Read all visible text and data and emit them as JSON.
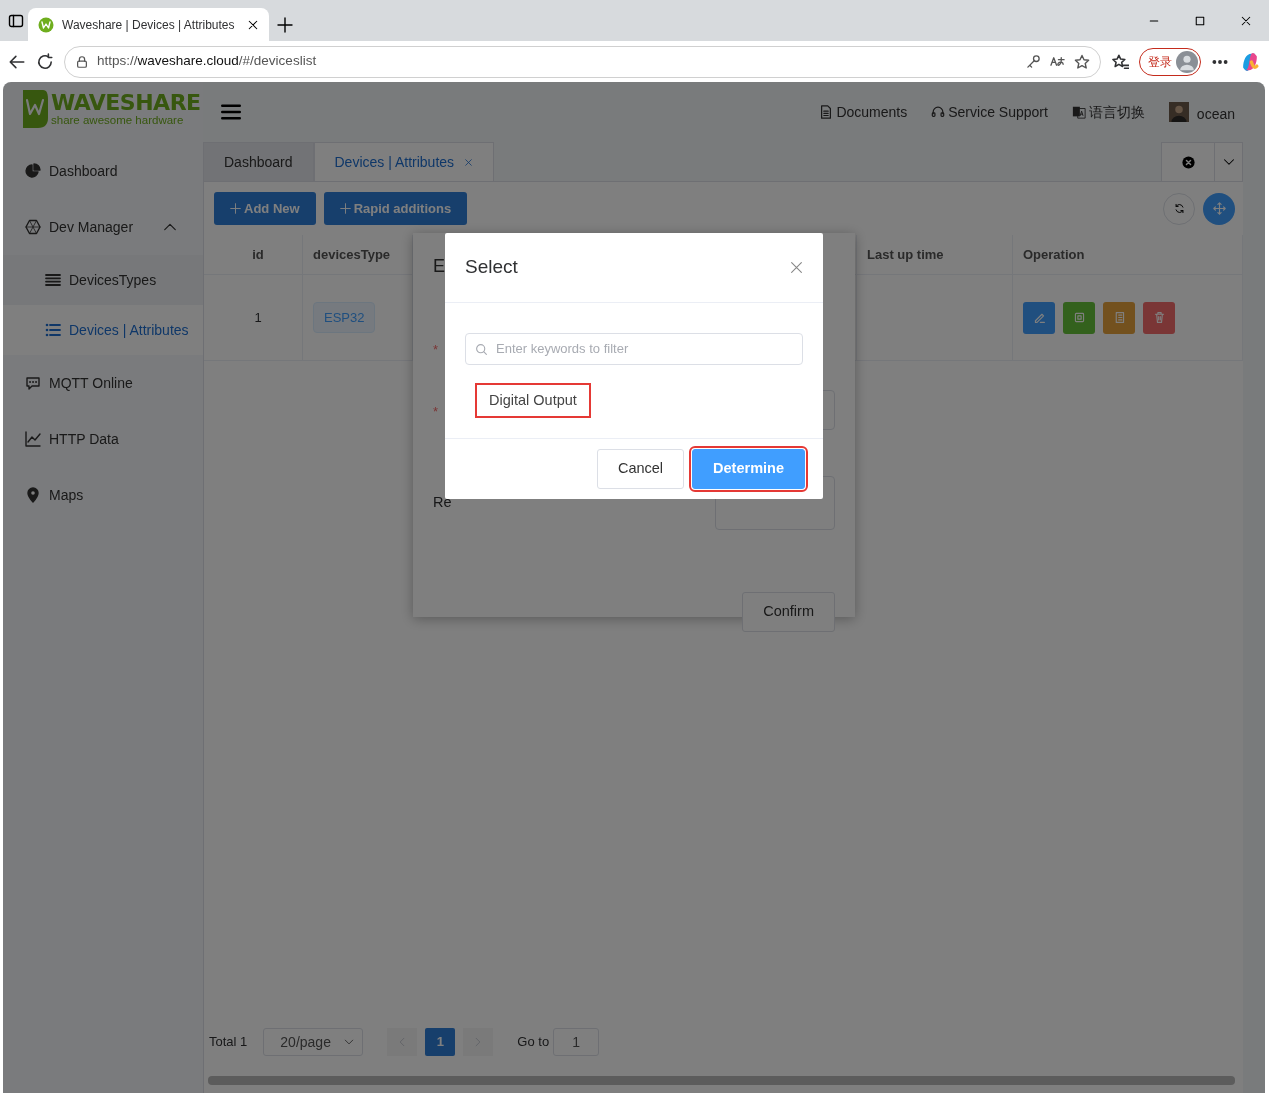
{
  "browser": {
    "tab_title": "Waveshare | Devices | Attributes",
    "url_scheme": "https://",
    "url_host": "waveshare.cloud",
    "url_path": "/#/deviceslist",
    "sign_in": "登录"
  },
  "header": {
    "brand": "WAVESHARE",
    "tagline": "share awesome hardware",
    "links": [
      {
        "label": "Documents",
        "kind": "document"
      },
      {
        "label": "Service Support",
        "kind": "headset"
      },
      {
        "label": "语言切换",
        "kind": "language"
      }
    ],
    "user": "ocean"
  },
  "sidebar": {
    "items": [
      {
        "label": "Dashboard",
        "kind": "pie",
        "selected": false
      },
      {
        "label": "Dev Manager",
        "kind": "hexagon",
        "selected": false,
        "expanded": true,
        "children": [
          {
            "label": "DevicesTypes",
            "kind": "bars",
            "selected": false
          },
          {
            "label": "Devices | Attributes",
            "kind": "list",
            "selected": true
          }
        ]
      },
      {
        "label": "MQTT Online",
        "kind": "chat",
        "selected": false
      },
      {
        "label": "HTTP Data",
        "kind": "chart",
        "selected": false
      },
      {
        "label": "Maps",
        "kind": "pin",
        "selected": false
      }
    ]
  },
  "tabs": [
    {
      "label": "Dashboard",
      "selected": false,
      "closable": false
    },
    {
      "label": "Devices | Attributes",
      "selected": true,
      "closable": true
    }
  ],
  "toolbar": {
    "buttons": [
      "Add New",
      "Rapid additions"
    ]
  },
  "table": {
    "columns": [
      {
        "label": "id",
        "kind": "id"
      },
      {
        "label": "devicesType",
        "kind": "type"
      },
      {
        "label": "Last up time",
        "kind": "time"
      },
      {
        "label": "Operation",
        "kind": "ops"
      }
    ],
    "rows": [
      {
        "id": "1",
        "devicesType": "ESP32",
        "operations": [
          {
            "kind": "edit"
          },
          {
            "kind": "chip"
          },
          {
            "kind": "notes"
          },
          {
            "kind": "delete"
          }
        ]
      }
    ]
  },
  "pagination": {
    "total": "Total 1",
    "page_size": "20/page",
    "pages": [
      {
        "label": "1",
        "selected": true
      }
    ],
    "goto_label": "Go to",
    "goto_value": "1"
  },
  "edit_dialog": {
    "title": "E",
    "required_marks": [
      "*",
      "*"
    ],
    "label": "Re",
    "confirm": "Confirm"
  },
  "select_dialog": {
    "backdrop": true,
    "title": "Select",
    "search": {
      "placeholder": "Enter keywords to filter"
    },
    "options": [
      {
        "label": "Digital Output",
        "highlighted": true
      }
    ],
    "buttons": [
      {
        "label": "Cancel",
        "kind": "default",
        "highlighted": false
      },
      {
        "label": "Determine",
        "kind": "primary",
        "highlighted": true
      }
    ]
  }
}
